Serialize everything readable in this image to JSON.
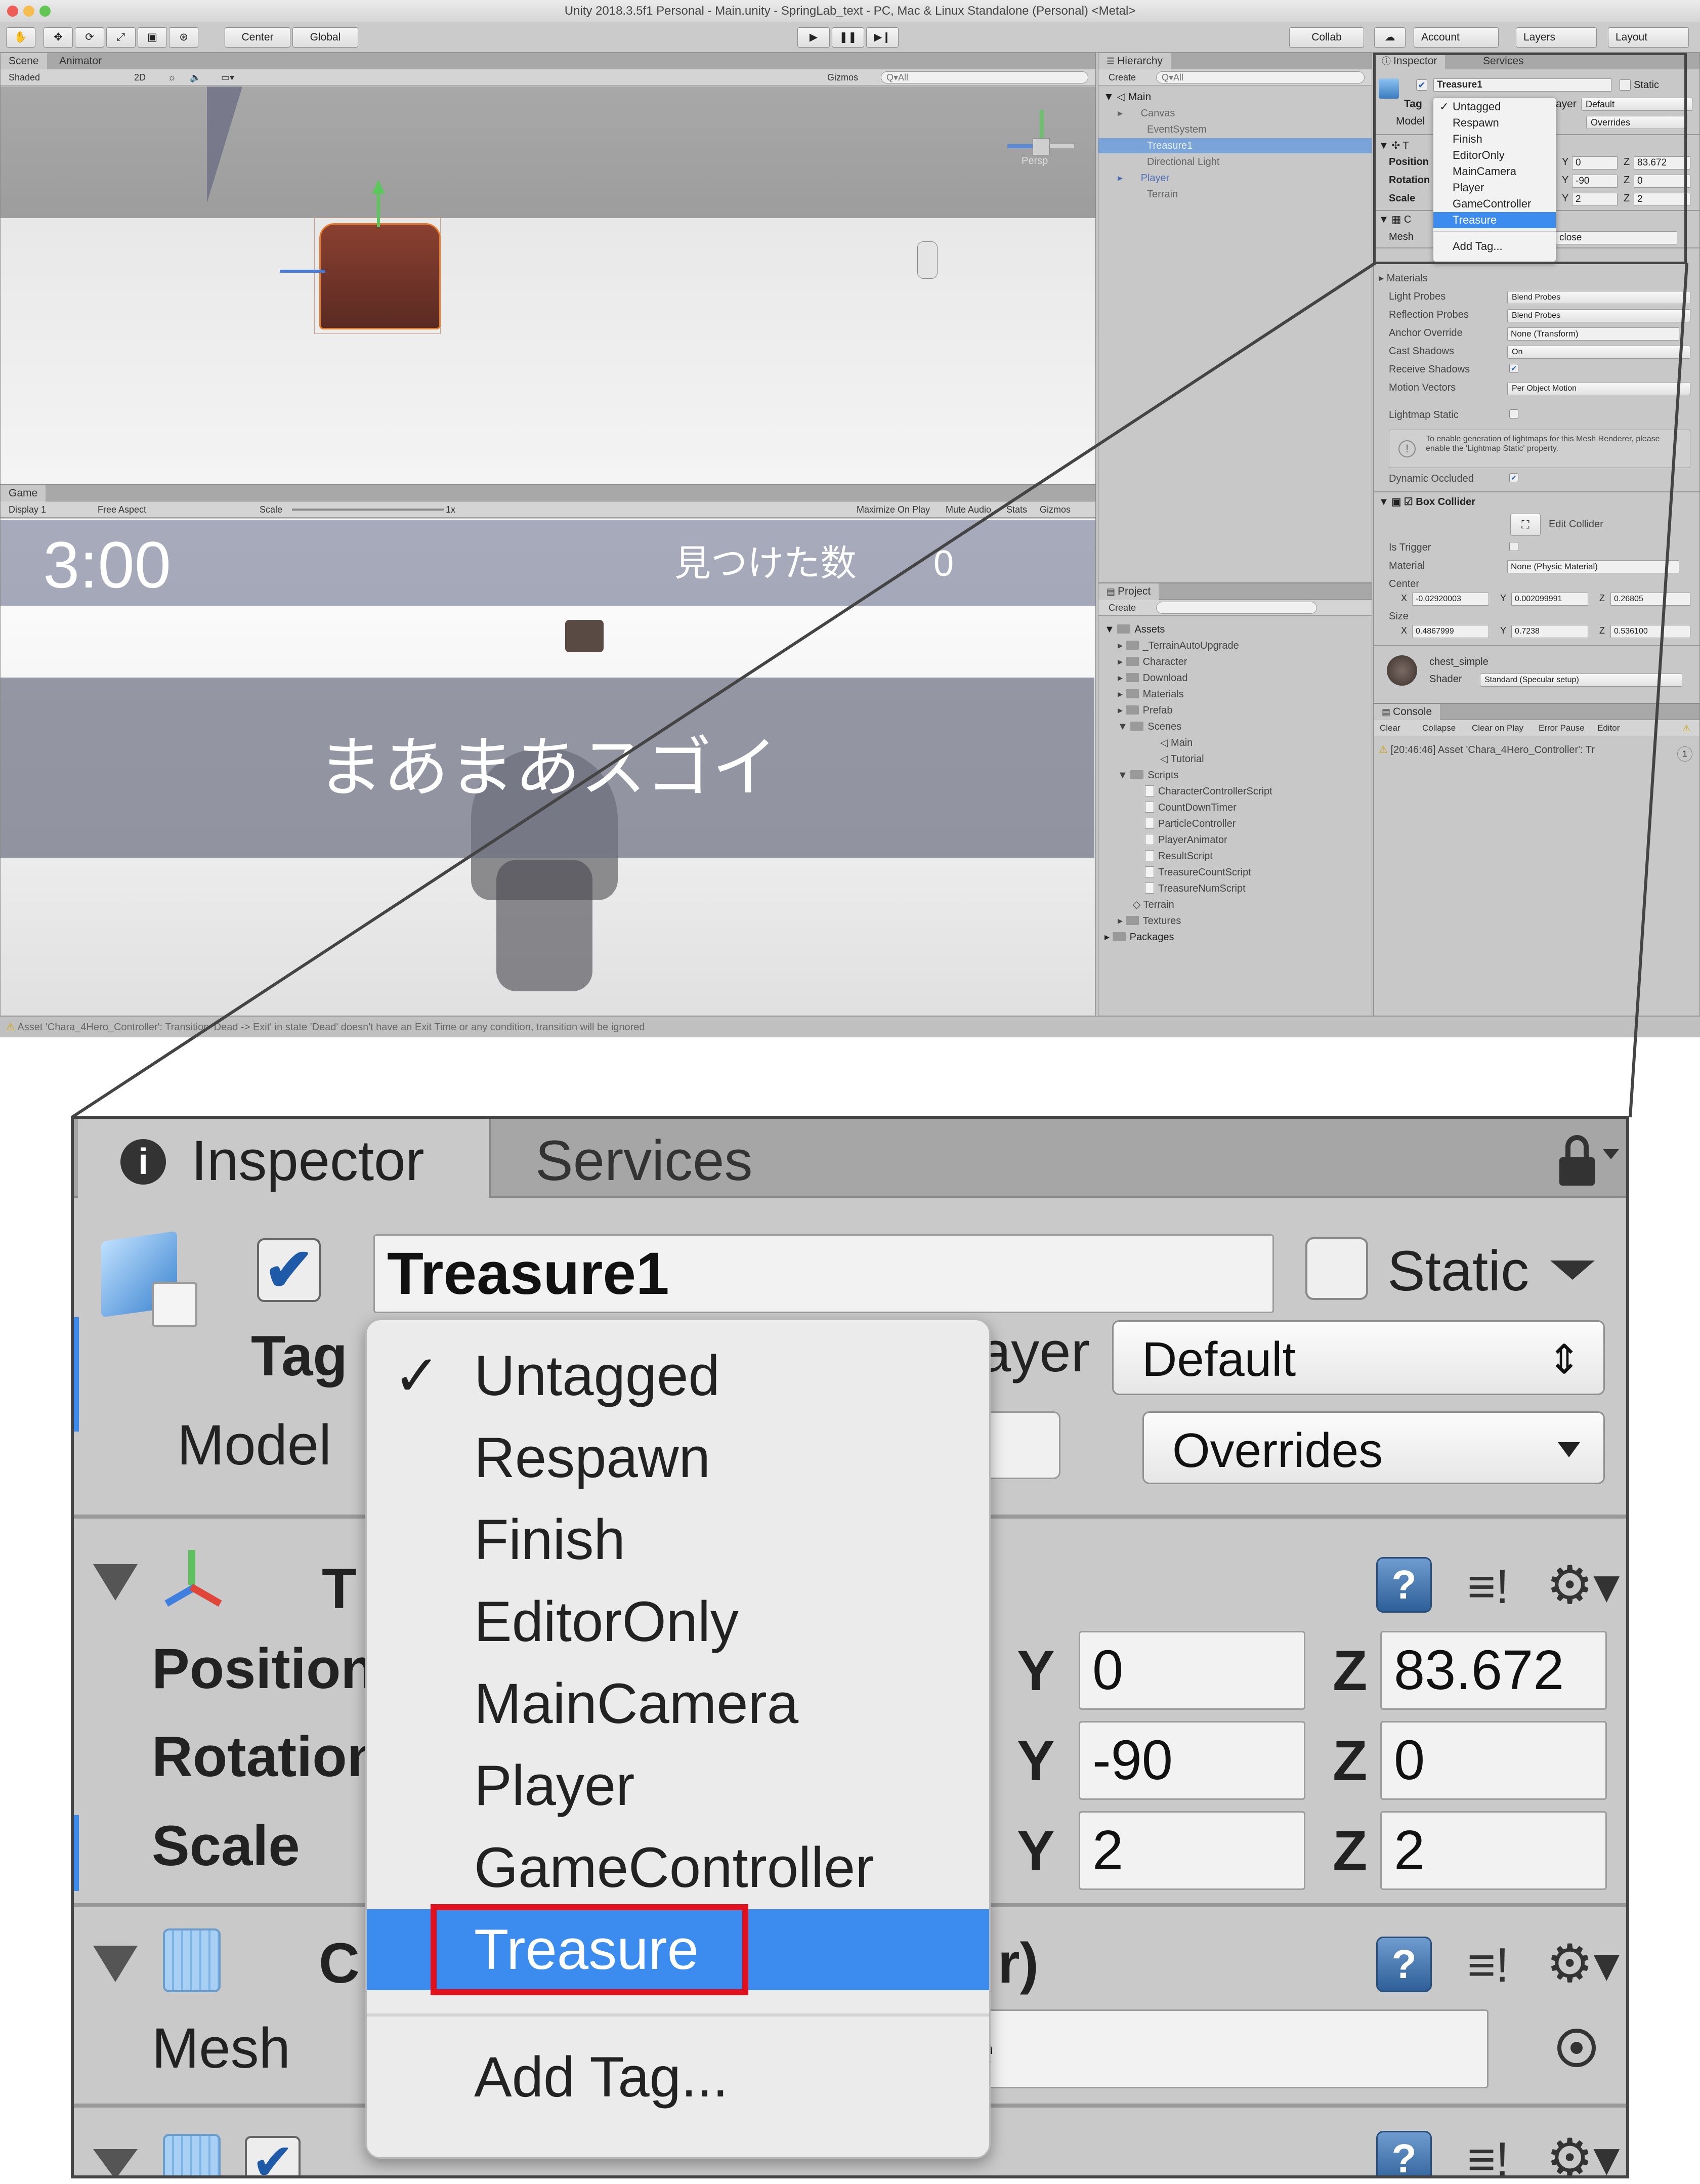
{
  "window_title": "Unity 2018.3.5f1 Personal - Main.unity - SpringLab_text - PC, Mac & Linux Standalone (Personal) <Metal>",
  "toolbar": {
    "pivot": "Center",
    "space": "Global",
    "collab": "Collab",
    "account": "Account",
    "layers": "Layers",
    "layout": "Layout"
  },
  "scene": {
    "tabs": [
      "Scene",
      "Animator"
    ],
    "shading": "Shaded",
    "mode2d": "2D",
    "gizmos": "Gizmos",
    "search_placeholder": "Q▾All",
    "persp": "Persp"
  },
  "game": {
    "tab": "Game",
    "display": "Display 1",
    "aspect": "Free Aspect",
    "scale_label": "Scale",
    "scale_value": "1x",
    "maximize": "Maximize On Play",
    "mute": "Mute Audio",
    "stats": "Stats",
    "gizmos": "Gizmos",
    "timer": "3:00",
    "found_label": "見つけた数",
    "found_count": "0",
    "result_text": "まあまあスゴイ"
  },
  "hierarchy": {
    "tab": "Hierarchy",
    "create": "Create",
    "search_placeholder": "Q▾All",
    "scene_name": "Main",
    "items": [
      "Canvas",
      "EventSystem",
      "Treasure1",
      "Directional Light",
      "Player",
      "Terrain"
    ]
  },
  "project": {
    "tab": "Project",
    "create": "Create",
    "assets": "Assets",
    "folders": [
      "_TerrainAutoUpgrade",
      "Character",
      "Download",
      "Materials",
      "Prefab",
      "Scenes"
    ],
    "scenes": [
      "Main",
      "Tutorial"
    ],
    "scripts_folder": "Scripts",
    "scripts": [
      "CharacterControllerScript",
      "CountDownTimer",
      "ParticleController",
      "PlayerAnimator",
      "ResultScript",
      "TreasureCountScript",
      "TreasureNumScript"
    ],
    "folders_after": [
      "Terrain",
      "Textures"
    ],
    "packages": "Packages"
  },
  "inspector": {
    "tabs": [
      "Inspector",
      "Services"
    ],
    "object_name": "Treasure1",
    "static_label": "Static",
    "tag_label": "Tag",
    "layer_label": "ayer",
    "layer_value": "Default",
    "model_label": "Model",
    "overrides": "Overrides",
    "transform_short": "T",
    "position_label": "Position",
    "rotation_label": "Rotation",
    "scale_label": "Scale",
    "position": {
      "y": "0",
      "z": "83.672"
    },
    "rotation": {
      "y": "-90",
      "z": "0"
    },
    "scale": {
      "y": "2",
      "z": "2"
    },
    "component_short": "C",
    "component_tail": "r)",
    "mesh_label": "Mesh",
    "mesh_value": "close",
    "materials": "Materials",
    "light_probes": "Light Probes",
    "light_probes_value": "Blend Probes",
    "reflection_probes": "Reflection Probes",
    "reflection_probes_value": "Blend Probes",
    "anchor_override": "Anchor Override",
    "anchor_override_value": "None (Transform)",
    "cast_shadows": "Cast Shadows",
    "cast_shadows_value": "On",
    "receive_shadows": "Receive Shadows",
    "motion_vectors": "Motion Vectors",
    "motion_vectors_value": "Per Object Motion",
    "lightmap_static": "Lightmap Static",
    "lightmap_info": "To enable generation of lightmaps for this Mesh Renderer, please enable the 'Lightmap Static' property.",
    "dynamic_occluded": "Dynamic Occluded",
    "box_collider": "Box Collider",
    "edit_collider": "Edit Collider",
    "is_trigger": "Is Trigger",
    "material_label": "Material",
    "material_value": "None (Physic Material)",
    "center_label": "Center",
    "center": {
      "x": "-0.02920003",
      "y": "0.002099991",
      "z": "0.26805"
    },
    "size_label": "Size",
    "size": {
      "x": "0.4867999",
      "y": "0.7238",
      "z": "0.536100"
    },
    "material_name": "chest_simple",
    "shader_label": "Shader",
    "shader_value": "Standard (Specular setup)"
  },
  "tag_menu": {
    "items": [
      "Untagged",
      "Respawn",
      "Finish",
      "EditorOnly",
      "MainCamera",
      "Player",
      "GameController",
      "Treasure"
    ],
    "checked": "Untagged",
    "selected": "Treasure",
    "add_tag": "Add Tag..."
  },
  "console": {
    "tab": "Console",
    "buttons": [
      "Clear",
      "Collapse",
      "Clear on Play",
      "Error Pause",
      "Editor"
    ],
    "message": "[20:46:46] Asset 'Chara_4Hero_Controller': Tr",
    "count": "1"
  },
  "status_bar": "Asset 'Chara_4Hero_Controller': Transition 'Dead -> Exit' in state 'Dead' doesn't have an Exit Time or any condition, transition will be ignored",
  "colors": {
    "selection": "#3c8cf0",
    "highlight_box": "#e0101c",
    "panel": "#c8c8c8"
  }
}
